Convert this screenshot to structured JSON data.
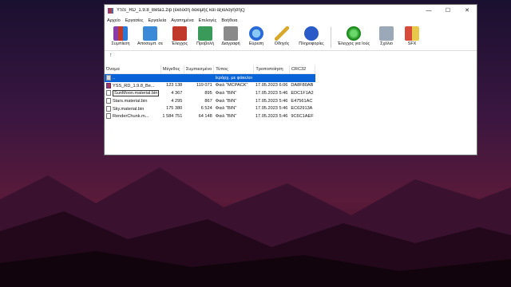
{
  "window": {
    "title": "YSS_RD_1.9.8_Beta1.zip (έκδοση δοκιμής και αξιολόγησης)",
    "controls": [
      "—",
      "☐",
      "✕"
    ]
  },
  "menu": [
    "Αρχείο",
    "Εργασίες",
    "Εργαλεία",
    "Αγαπημένα",
    "Επιλογές",
    "Βοήθεια"
  ],
  "toolbar": [
    {
      "label": "Συμπίεση",
      "icon": "archive-icon",
      "color": "#8a3aa8"
    },
    {
      "label": "Αποσυμπ. σε",
      "icon": "folder-icon",
      "color": "#3a8ad8"
    },
    {
      "label": "Έλεγχος",
      "icon": "clipboard-check-icon",
      "color": "#c0392b"
    },
    {
      "label": "Προβολή",
      "icon": "book-icon",
      "color": "#3a9a5a"
    },
    {
      "label": "Διαγραφή",
      "icon": "trash-icon",
      "color": "#8a8a8a"
    },
    {
      "label": "Εύρεση",
      "icon": "magnifier-icon",
      "color": "#2a6ad8"
    },
    {
      "label": "Οδηγός",
      "icon": "wand-icon",
      "color": "#d8a82a"
    },
    {
      "label": "Πληροφορίες",
      "icon": "info-icon",
      "color": "#2a5ac8"
    },
    {
      "label": "Έλεγχος για Ιούς",
      "icon": "virus-scan-icon",
      "color": "#2aa82a"
    },
    {
      "label": "Σχόλιο",
      "icon": "comment-icon",
      "color": "#9aa8b8"
    },
    {
      "label": "SFX",
      "icon": "sfx-icon",
      "color": "#d84a3a"
    }
  ],
  "up_arrow": "↑",
  "columns": [
    "Όνομα",
    "Μέγεθος",
    "Συμπιεσμένο",
    "Τύπος",
    "Τροποποίηση",
    "CRC32"
  ],
  "rows": [
    {
      "name": "..",
      "size": "",
      "packed": "",
      "type": "Ιεράρχ. με φάκελοι",
      "modified": "",
      "crc": "",
      "selected": true,
      "kind": "up"
    },
    {
      "name": "YSS_RD_1.9.8_Be...",
      "size": "123 138",
      "packed": "119 071",
      "type": "Φαιλ \"MCPACK\"",
      "modified": "17.05.2023 6:06",
      "crc": "DA8F80AB",
      "kind": "pack"
    },
    {
      "name": "SunMoon.material.bin",
      "size": "4 367",
      "packed": "895",
      "type": "Φαιλ \"BIN\"",
      "modified": "17.05.2023 5:46",
      "crc": "EDC1F1A2",
      "kind": "file",
      "editing": true
    },
    {
      "name": "Stars.material.bin",
      "size": "4 295",
      "packed": "867",
      "type": "Φαιλ \"BIN\"",
      "modified": "17.05.2023 5:46",
      "crc": "E47561AC",
      "kind": "file"
    },
    {
      "name": "Sky.material.bin",
      "size": "175 380",
      "packed": "6 524",
      "type": "Φαιλ \"BIN\"",
      "modified": "17.05.2023 5:46",
      "crc": "EC62913A",
      "kind": "file"
    },
    {
      "name": "RenderChunk.m...",
      "size": "1 584 751",
      "packed": "64 148",
      "type": "Φαιλ \"BIN\"",
      "modified": "17.05.2023 5:46",
      "crc": "9C6C1AEF",
      "kind": "file"
    }
  ]
}
